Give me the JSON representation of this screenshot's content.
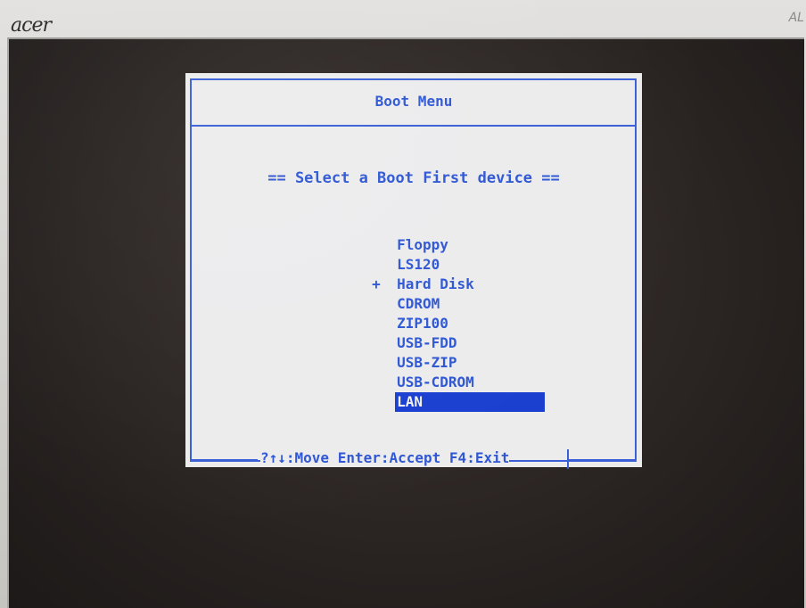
{
  "monitor": {
    "brand": "acer",
    "model_fragment": "AL"
  },
  "dialog": {
    "title": "Boot Menu",
    "subtitle": "== Select a Boot First device ==",
    "devices": [
      {
        "label": "Floppy",
        "marker": ""
      },
      {
        "label": "LS120",
        "marker": ""
      },
      {
        "label": "Hard Disk",
        "marker": "+"
      },
      {
        "label": "CDROM",
        "marker": ""
      },
      {
        "label": "ZIP100",
        "marker": ""
      },
      {
        "label": "USB-FDD",
        "marker": ""
      },
      {
        "label": "USB-ZIP",
        "marker": ""
      },
      {
        "label": "USB-CDROM",
        "marker": ""
      },
      {
        "label": "LAN",
        "marker": "",
        "selected": true
      }
    ],
    "footer": "?↑↓:Move Enter:Accept F4:Exit"
  },
  "colors": {
    "text_blue": "#2f57d4",
    "frame_blue": "#3a5fd6",
    "selection_bg": "#1a3fd0",
    "dialog_bg": "#ececed",
    "screen_bg": "#2a2422"
  }
}
